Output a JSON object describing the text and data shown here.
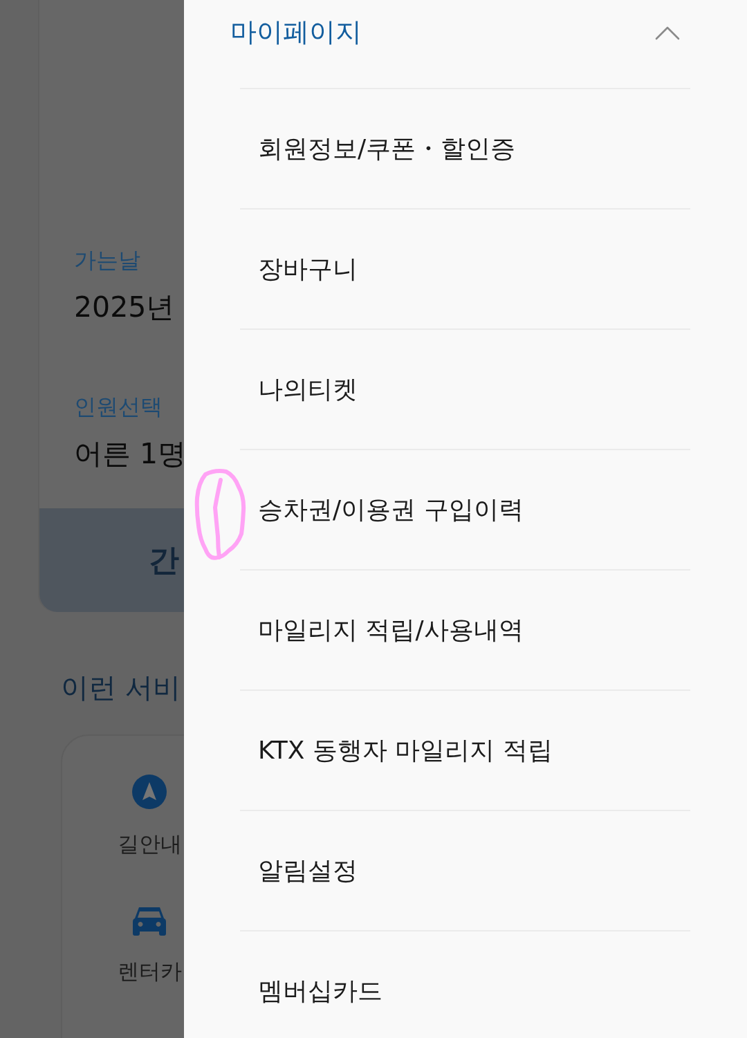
{
  "background_page": {
    "trip_card": {
      "fields": [
        {
          "label": "가는날",
          "value": "2025년"
        },
        {
          "label": "인원선택",
          "value": "어른 1명"
        }
      ],
      "button": "간"
    },
    "services": {
      "title": "이런 서비",
      "items": [
        {
          "kind": "navigation",
          "label": "길안내"
        },
        {
          "kind": "car",
          "label": "렌터카"
        }
      ]
    }
  },
  "drawer": {
    "section": {
      "title": "마이페이지",
      "expanded": true,
      "items": [
        "회원정보/쿠폰・할인증",
        "장바구니",
        "나의티켓",
        "승차권/이용권 구입이력",
        "마일리지 적립/사용내역",
        "KTX 동행자 마일리지 적립",
        "알림설정",
        "멤버십카드"
      ]
    }
  }
}
